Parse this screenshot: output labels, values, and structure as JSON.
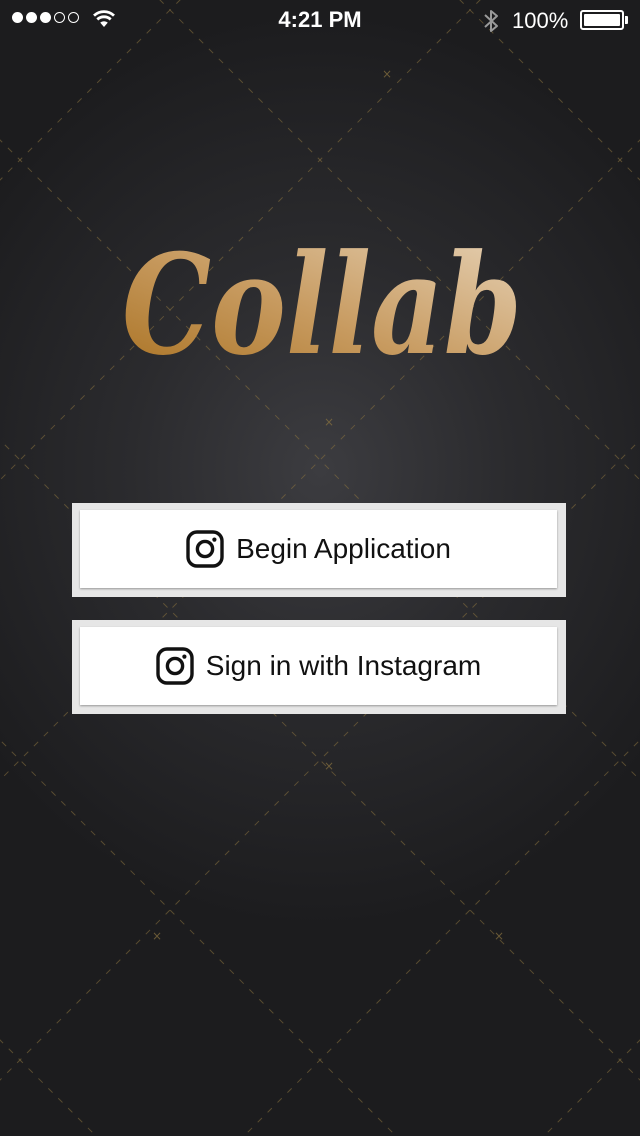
{
  "status_bar": {
    "time": "4:21 PM",
    "battery_percent": "100%",
    "signal_bars_filled": 3,
    "signal_bars_total": 5,
    "icons": [
      "signal-dots-icon",
      "wifi-icon",
      "bluetooth-icon",
      "battery-icon"
    ]
  },
  "logo": {
    "text": "Collab"
  },
  "buttons": {
    "begin_application": {
      "label": "Begin Application",
      "icon": "instagram-icon"
    },
    "sign_in_instagram": {
      "label": "Sign in with Instagram",
      "icon": "instagram-icon"
    }
  },
  "colors": {
    "background": "#2b2b2e",
    "logo_gradient_start": "#a8701f",
    "logo_gradient_end": "#e3cdb0",
    "pattern_line": "#8a7340",
    "button_frame": "#e6e6e6",
    "button_fill": "#ffffff"
  }
}
